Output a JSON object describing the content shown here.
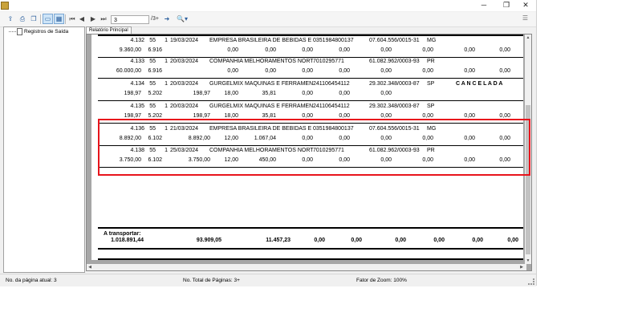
{
  "window": {
    "title": "",
    "controls": {
      "minimize": "─",
      "maximize": "❐",
      "close": "✕"
    }
  },
  "toolbar": {
    "page_value": "3",
    "page_total": "/3+",
    "icons": [
      "export-icon",
      "print-icon",
      "copy-icon",
      "single-page-icon",
      "multi-page-icon",
      "first-page-icon",
      "prev-page-icon",
      "next-page-icon",
      "last-page-icon",
      "goto-icon",
      "zoom-icon",
      "overflow-icon"
    ]
  },
  "tree": {
    "items": [
      {
        "label": "Registros de Saída"
      }
    ]
  },
  "tab": {
    "label": "Relatório Principal"
  },
  "report": {
    "records": [
      {
        "num": "4.132",
        "a": "55",
        "b": "1",
        "date": "19/03/2024",
        "company": "EMPRESA BRASILEIRA DE BEBIDAS E ALI",
        "ie": "0351984800137",
        "cnpj": "07.604.556/0015-31",
        "uf": "MG",
        "status": "",
        "l2": [
          "9.360,00",
          "6.916",
          "",
          "0,00",
          "0,00",
          "0,00",
          "0,00",
          "0,00",
          "0,00",
          "0,00",
          "0,00"
        ]
      },
      {
        "num": "4.133",
        "a": "55",
        "b": "1",
        "date": "20/03/2024",
        "company": "COMPANHIA MELHORAMENTOS NORTE DO",
        "ie": "7010295771",
        "cnpj": "61.082.962/0003-93",
        "uf": "PR",
        "status": "",
        "l2": [
          "60.000,00",
          "6.916",
          "",
          "0,00",
          "0,00",
          "0,00",
          "0,00",
          "0,00",
          "0,00",
          "0,00",
          "0,00"
        ]
      },
      {
        "num": "4.134",
        "a": "55",
        "b": "1",
        "date": "20/03/2024",
        "company": "GURGELMIX MAQUINAS E FERRAMENTAS",
        "ie": "241106454112",
        "cnpj": "29.302.348/0003-87",
        "uf": "SP",
        "status": "C A N C E L A D A",
        "l2": [
          "198,97",
          "5.202",
          "198,97",
          "18,00",
          "35,81",
          "0,00",
          "0,00",
          "0,00",
          "",
          "",
          ""
        ]
      },
      {
        "num": "4.135",
        "a": "55",
        "b": "1",
        "date": "20/03/2024",
        "company": "GURGELMIX MAQUINAS E FERRAMENTAS",
        "ie": "241106454112",
        "cnpj": "29.302.348/0003-87",
        "uf": "SP",
        "status": "",
        "l2": [
          "198,97",
          "5.202",
          "198,97",
          "18,00",
          "35,81",
          "0,00",
          "0,00",
          "0,00",
          "0,00",
          "0,00",
          "0,00"
        ]
      },
      {
        "num": "4.136",
        "a": "55",
        "b": "1",
        "date": "21/03/2024",
        "company": "EMPRESA BRASILEIRA DE BEBIDAS E ALI",
        "ie": "0351984800137",
        "cnpj": "07.604.556/0015-31",
        "uf": "MG",
        "status": "",
        "l2": [
          "8.892,00",
          "6.102",
          "8.892,00",
          "12,00",
          "1.067,04",
          "0,00",
          "0,00",
          "0,00",
          "0,00",
          "0,00",
          "0,00"
        ]
      },
      {
        "num": "4.138",
        "a": "55",
        "b": "1",
        "date": "25/03/2024",
        "company": "COMPANHIA MELHORAMENTOS NORTE DO",
        "ie": "7010295771",
        "cnpj": "61.082.962/0003-93",
        "uf": "PR",
        "status": "",
        "l2": [
          "3.750,00",
          "6.102",
          "3.750,00",
          "12,00",
          "450,00",
          "0,00",
          "0,00",
          "0,00",
          "0,00",
          "0,00",
          "0,00"
        ]
      }
    ],
    "transport": {
      "label": "A transportar:",
      "values": [
        "1.018.891,44",
        "93.909,05",
        "11.457,23",
        "0,00",
        "0,00",
        "0,00",
        "0,00",
        "0,00",
        "0,00"
      ]
    }
  },
  "status": {
    "current_page": "No. da página atual: 3",
    "total_pages": "No. Total de Páginas: 3+",
    "zoom": "Fator de Zoom: 100%"
  }
}
